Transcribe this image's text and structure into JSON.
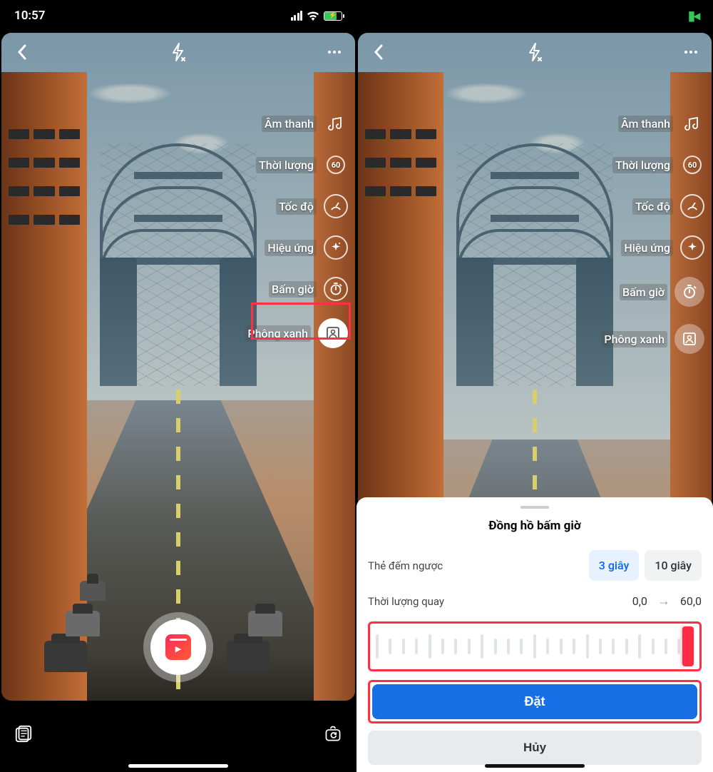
{
  "status": {
    "time": "10:57"
  },
  "menu": {
    "sound": "Âm thanh",
    "duration": "Thời lượng",
    "duration_badge": "60",
    "speed": "Tốc độ",
    "effects": "Hiệu ứng",
    "timer": "Bấm giờ",
    "greenscreen": "Phông xanh"
  },
  "sheet": {
    "title": "Đồng hồ bấm giờ",
    "countdown_label": "Thẻ đếm ngược",
    "opt_3s": "3 giây",
    "opt_10s": "10 giây",
    "rec_label": "Thời lượng quay",
    "from": "0,0",
    "to": "60,0",
    "set": "Đặt",
    "cancel": "Hủy"
  }
}
